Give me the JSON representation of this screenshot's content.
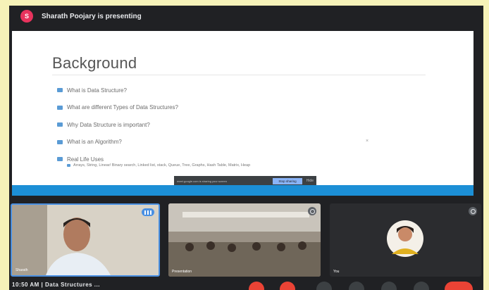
{
  "header": {
    "presenting_text": "Sharath Poojary is presenting",
    "presenter_initial": "S"
  },
  "slide": {
    "title": "Background",
    "bullets": [
      "What is Data Structure?",
      "What are different Types of Data Structures?",
      "Why Data Structure is important?",
      "What is an Algorithm?",
      "Real Life Uses"
    ],
    "sub_bullet": "Arrays, String, Linear/ Binary search, Linked list, stack, Queue, Tree, Graphs, Hash Table, Matrix, Heap"
  },
  "share_bar": {
    "message": "meet.google.com is sharing your screen",
    "hide_label": "Stop sharing",
    "close_label": "Hide"
  },
  "participants": [
    {
      "name": "Sharath",
      "speaking": true
    },
    {
      "name": "Presentation",
      "speaking": false
    },
    {
      "name": "You",
      "speaking": false
    }
  ],
  "footer": {
    "meeting_title": "10:50 AM | Data Structures ..."
  },
  "colors": {
    "page_bg": "#f6f2b8",
    "meet_bg": "#202124",
    "accent_blue": "#1c8fd6",
    "end_call_red": "#ea4335"
  }
}
